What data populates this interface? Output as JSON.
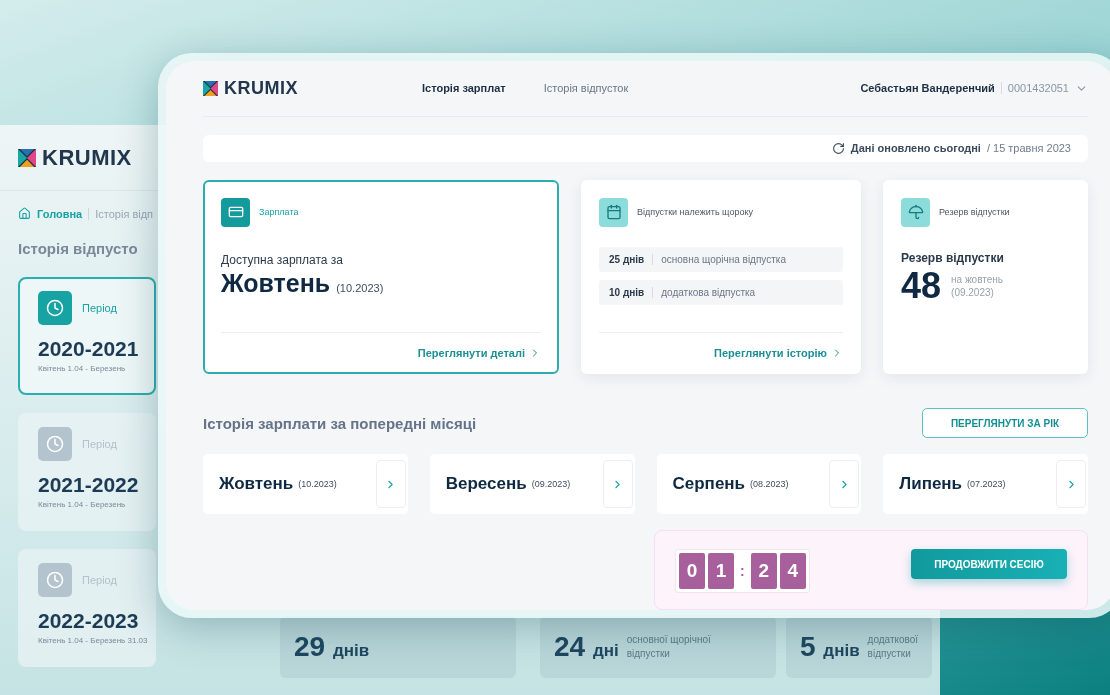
{
  "background_window": {
    "logo": "KRUMIX",
    "breadcrumb": [
      {
        "label": "Головна",
        "selected": true
      },
      {
        "label": "Історія відп",
        "selected": false
      }
    ],
    "title": "Історія відпусто",
    "periods": [
      {
        "label": "Період",
        "value": "2020-2021",
        "dates": "Квітень 1.04 - Березень",
        "selected": true
      },
      {
        "label": "Період",
        "value": "2021-2022",
        "dates": "Квітень 1.04 - Березень",
        "selected": false
      },
      {
        "label": "Період",
        "value": "2022-2023",
        "dates": "Квітень 1.04 - Березень 31.03",
        "selected": false
      }
    ],
    "stats": [
      {
        "value": "29",
        "unit": "днів"
      },
      {
        "value": "24",
        "unit": "дні",
        "note": "основної щорічної відпустки"
      },
      {
        "value": "5",
        "unit": "днів",
        "note": "додаткової відпустки"
      }
    ]
  },
  "main_window": {
    "logo": "KRUMIX",
    "nav": [
      {
        "label": "Історія зарплат",
        "selected": true
      },
      {
        "label": "Історія відпусток",
        "selected": false
      }
    ],
    "user": {
      "name": "Себастьян Вандеренчий",
      "id": "0001432051"
    },
    "update": {
      "status": "Дані оновлено сьогодні",
      "date": "/ 15 травня 2023"
    },
    "cards": [
      {
        "kind": "salary",
        "label": "Зарплата",
        "selected": true,
        "subtitle": "Доступна зарплата за",
        "month": "Жовтень",
        "date": "(10.2023)",
        "link": "Переглянути деталі"
      },
      {
        "kind": "vacation",
        "label": "Відпустки належить щороку",
        "selected": false,
        "rows": [
          {
            "value": "25 днів",
            "text": "основна щорічна відпустка"
          },
          {
            "value": "10 днів",
            "text": "додаткова відпустка"
          }
        ],
        "link": "Переглянути історію"
      },
      {
        "kind": "reserve",
        "label": "Резерв відпустки",
        "selected": false,
        "title": "Резерв відпустки",
        "value": "48",
        "note": "на жовтень",
        "date": "(09.2023)"
      }
    ],
    "history": {
      "title": "Історія зарплати за попередні місяці",
      "button": "ПЕРЕГЛЯНУТИ ЗА РІК",
      "months": [
        {
          "name": "Жовтень",
          "date": "(10.2023)"
        },
        {
          "name": "Вересень",
          "date": "(09.2023)"
        },
        {
          "name": "Серпень",
          "date": "(08.2023)"
        },
        {
          "name": "Липень",
          "date": "(07.2023)"
        }
      ]
    },
    "session": {
      "minutes": [
        "0",
        "1"
      ],
      "separator": ":",
      "seconds": [
        "2",
        "4"
      ],
      "button": "ПРОДОВЖИТИ СЕСІЮ"
    }
  }
}
